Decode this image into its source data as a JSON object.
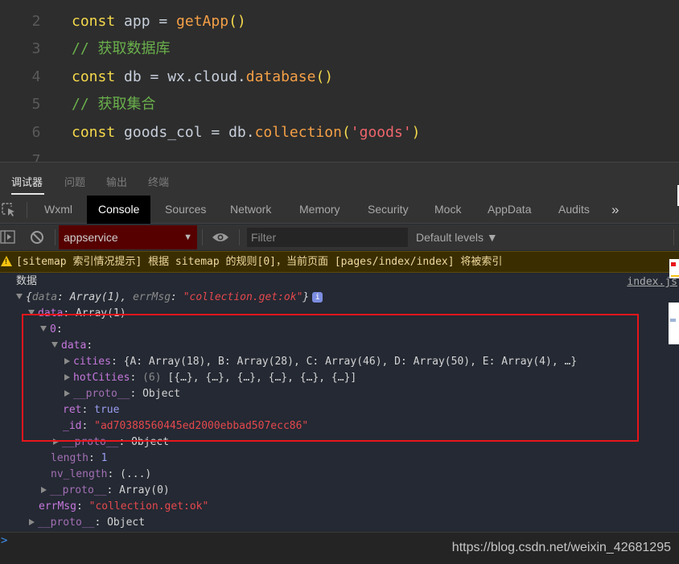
{
  "editor": {
    "lines": [
      {
        "num": "2",
        "tokens": [
          [
            "kw",
            "const"
          ],
          [
            "pl",
            " app = "
          ],
          [
            "fn",
            "getApp"
          ],
          [
            "pn",
            "()"
          ]
        ]
      },
      {
        "num": "3",
        "tokens": [
          [
            "cm",
            "// 获取数据库"
          ]
        ]
      },
      {
        "num": "4",
        "tokens": [
          [
            "kw",
            "const"
          ],
          [
            "pl",
            " db = wx.cloud."
          ],
          [
            "fn",
            "database"
          ],
          [
            "pn",
            "()"
          ]
        ]
      },
      {
        "num": "5",
        "tokens": [
          [
            "cm",
            "// 获取集合"
          ]
        ]
      },
      {
        "num": "6",
        "tokens": [
          [
            "kw",
            "const"
          ],
          [
            "pl",
            " goods_col = db."
          ],
          [
            "fn",
            "collection"
          ],
          [
            "pn",
            "("
          ],
          [
            "str",
            "'goods'"
          ],
          [
            "pn",
            ")"
          ]
        ]
      },
      {
        "num": "7",
        "tokens": []
      }
    ]
  },
  "panel_tabs": [
    "调试器",
    "问题",
    "输出",
    "终端"
  ],
  "panel_tab_active": "调试器",
  "devtools": {
    "inspect_icon": "inspect-element-icon",
    "tabs": [
      "Wxml",
      "Console",
      "Sources",
      "Network",
      "Memory",
      "Security",
      "Mock",
      "AppData",
      "Audits"
    ],
    "active_tab": "Console",
    "more_label": "»"
  },
  "toolbar": {
    "context": "appservice",
    "filter_placeholder": "Filter",
    "levels_label": "Default levels ▼"
  },
  "warning": {
    "text": "[sitemap 索引情况提示] 根据 sitemap 的规则[0]，当前页面 [pages/index/index] 将被索引"
  },
  "console": {
    "log_label": "数据",
    "source_link": "index.js",
    "summary": {
      "open": "{",
      "k1": "data",
      "v1": "Array(1)",
      "k2": "errMsg",
      "v2": "\"collection.get:ok\"",
      "close": "}"
    },
    "tree": {
      "data_key": "data",
      "data_val": "Array(1)",
      "idx_key": "0",
      "inner_data_key": "data",
      "cities_key": "cities",
      "cities_val": "{A: Array(18), B: Array(28), C: Array(46), D: Array(50), E: Array(4), …}",
      "hot_key": "hotCities",
      "hot_count": "(6)",
      "hot_val": "[{…}, {…}, {…}, {…}, {…}, {…}]",
      "proto_key": "__proto__",
      "proto_obj": "Object",
      "ret_key": "ret",
      "ret_val": "true",
      "id_key": "_id",
      "id_val": "\"ad70388560445ed2000ebbad507ecc86\"",
      "length_key": "length",
      "length_val": "1",
      "nvlen_key": "nv_length",
      "nvlen_val": "(...)",
      "proto_arr": "Array(0)",
      "errmsg_key": "errMsg",
      "errmsg_val": "\"collection.get:ok\""
    }
  },
  "prompt": ">",
  "watermark": "https://blog.csdn.net/weixin_42681295"
}
